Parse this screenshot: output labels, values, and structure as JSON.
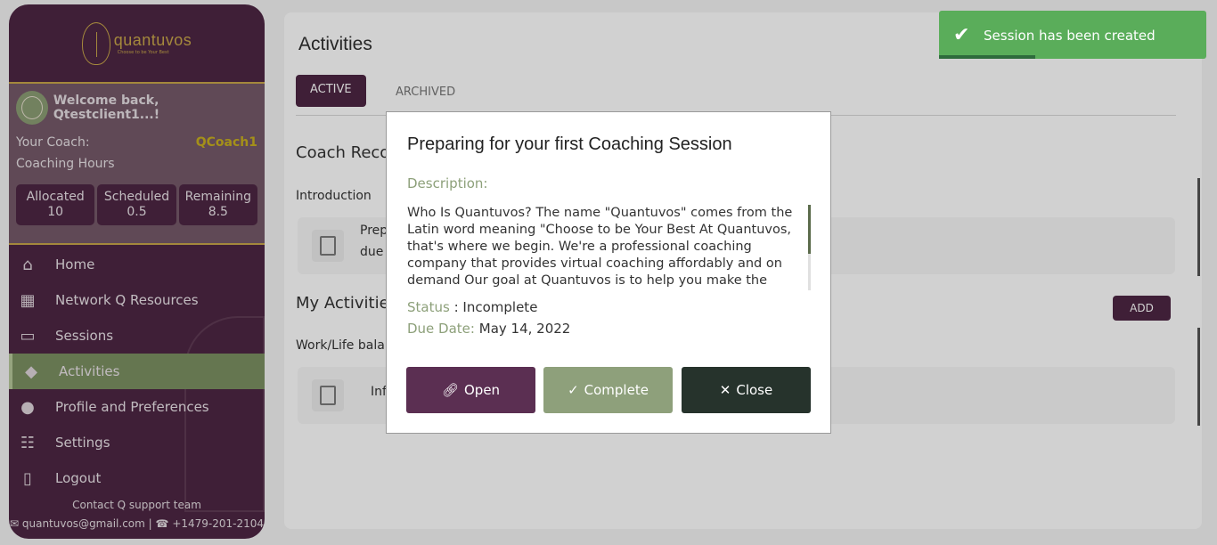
{
  "brand": {
    "name": "quantuvos",
    "tagline": "Choose to be Your Best"
  },
  "profile": {
    "welcome": "Welcome back, Qtestclient1...!",
    "coach_label": "Your Coach:",
    "coach_name": "QCoach1",
    "hours_label": "Coaching Hours",
    "hours": [
      {
        "label": "Allocated",
        "value": "10"
      },
      {
        "label": "Scheduled",
        "value": "0.5"
      },
      {
        "label": "Remaining",
        "value": "8.5"
      }
    ]
  },
  "nav": [
    {
      "label": "Home",
      "icon": "home-icon"
    },
    {
      "label": "Network Q Resources",
      "icon": "boxes-icon"
    },
    {
      "label": "Sessions",
      "icon": "chat-icon"
    },
    {
      "label": "Activities",
      "icon": "graduation-cap-icon",
      "active": true
    },
    {
      "label": "Profile and Preferences",
      "icon": "user-icon"
    },
    {
      "label": "Settings",
      "icon": "settings-icon"
    },
    {
      "label": "Logout",
      "icon": "logout-icon"
    }
  ],
  "footer": {
    "support": "Contact Q support team",
    "email": "quantuvos@gmail.com",
    "phone": "+1479-201-2104"
  },
  "main": {
    "title": "Activities",
    "tabs": {
      "active": "ACTIVE",
      "archived": "ARCHIVED"
    },
    "coach_section": "Coach Recom",
    "coach_group": "Introduction",
    "coach_card_line1": "Prep",
    "coach_card_line2": "due",
    "my_section": "My Activities",
    "add_label": "ADD",
    "my_group": "Work/Life bala",
    "my_card_text": "Inf"
  },
  "modal": {
    "title": "Preparing for your first Coaching Session",
    "description_label": "Description:",
    "description": "Who Is Quantuvos? The name \"Quantuvos\" comes from the Latin word meaning \"Choose to be Your Best At Quantuvos, that's where we begin. We're a professional coaching company that provides virtual coaching affordably and on demand Our goal at Quantuvos is to help you make the most",
    "status_label": "Status",
    "status_value": "Incomplete",
    "due_label": "Due Date:",
    "due_value": "May 14, 2022",
    "buttons": {
      "open": "Open",
      "complete": "Complete",
      "close": "Close"
    },
    "colors": {
      "open": "#5b2f52",
      "complete": "#8ea07b",
      "close": "#26332c"
    }
  },
  "toast": {
    "message": "Session has been created",
    "progress": 0.36,
    "color": "#5aad5a"
  }
}
